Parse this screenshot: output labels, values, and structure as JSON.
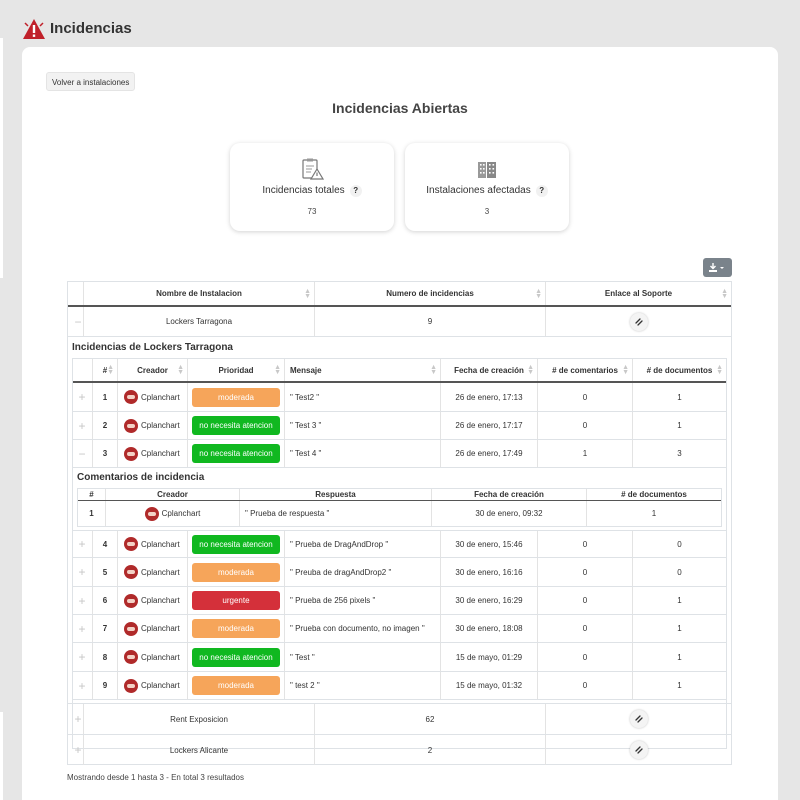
{
  "header": {
    "title": "Incidencias",
    "icon": "warning-triangle-icon",
    "accent": "#c0202a"
  },
  "back_button": "Volver a instalaciones",
  "section_title": "Incidencias Abiertas",
  "stats": [
    {
      "label": "Incidencias totales",
      "help": "?",
      "value": "73",
      "icon": "clipboard-warning-icon"
    },
    {
      "label": "Instalaciones afectadas",
      "help": "?",
      "value": "3",
      "icon": "building-icon"
    }
  ],
  "main_table": {
    "headers": [
      "Nombre de Instalacion",
      "Numero de incidencias",
      "Enlace al Soporte"
    ],
    "rows": [
      {
        "name": "Lockers Tarragona",
        "count": "9",
        "expanded": "−"
      },
      {
        "name": "Rent Exposicion",
        "count": "62",
        "expanded": "+"
      },
      {
        "name": "Lockers Alicante",
        "count": "2",
        "expanded": "+"
      }
    ]
  },
  "incidents": {
    "title": "Incidencias de Lockers Tarragona",
    "headers": [
      "#",
      "Creador",
      "Prioridad",
      "Mensaje",
      "Fecha de creación",
      "# de comentarios",
      "# de documentos"
    ],
    "rows": [
      {
        "exp": "+",
        "num": "1",
        "creator": "Cplanchart",
        "priority": "moderada",
        "message": "\" Test2 \"",
        "date": "26 de enero, 17:13",
        "comments": "0",
        "docs": "1"
      },
      {
        "exp": "+",
        "num": "2",
        "creator": "Cplanchart",
        "priority": "no necesita atencion",
        "message": "\" Test 3 \"",
        "date": "26 de enero, 17:17",
        "comments": "0",
        "docs": "1"
      },
      {
        "exp": "−",
        "num": "3",
        "creator": "Cplanchart",
        "priority": "no necesita atencion",
        "message": "\" Test 4 \"",
        "date": "26 de enero, 17:49",
        "comments": "1",
        "docs": "3"
      },
      {
        "exp": "+",
        "num": "4",
        "creator": "Cplanchart",
        "priority": "no necesita atencion",
        "message": "\" Prueba de DragAndDrop \"",
        "date": "30 de enero, 15:46",
        "comments": "0",
        "docs": "0"
      },
      {
        "exp": "+",
        "num": "5",
        "creator": "Cplanchart",
        "priority": "moderada",
        "message": "\" Preuba de dragAndDrop2 \"",
        "date": "30 de enero, 16:16",
        "comments": "0",
        "docs": "0"
      },
      {
        "exp": "+",
        "num": "6",
        "creator": "Cplanchart",
        "priority": "urgente",
        "message": "\" Prueba de 256 pixels \"",
        "date": "30 de enero, 16:29",
        "comments": "0",
        "docs": "1"
      },
      {
        "exp": "+",
        "num": "7",
        "creator": "Cplanchart",
        "priority": "moderada",
        "message": "\" Prueba con documento, no imagen \"",
        "date": "30 de enero, 18:08",
        "comments": "0",
        "docs": "1"
      },
      {
        "exp": "+",
        "num": "8",
        "creator": "Cplanchart",
        "priority": "no necesita atencion",
        "message": "\" Test \"",
        "date": "15 de mayo, 01:29",
        "comments": "0",
        "docs": "1"
      },
      {
        "exp": "+",
        "num": "9",
        "creator": "Cplanchart",
        "priority": "moderada",
        "message": "\" test 2 \"",
        "date": "15 de mayo, 01:32",
        "comments": "0",
        "docs": "1"
      }
    ]
  },
  "comments": {
    "title": "Comentarios de incidencia",
    "headers": [
      "#",
      "Creador",
      "Respuesta",
      "Fecha de creación",
      "# de documentos"
    ],
    "rows": [
      {
        "num": "1",
        "creator": "Cplanchart",
        "response": "\" Prueba de respuesta \"",
        "date": "30 de enero, 09:32",
        "docs": "1"
      }
    ]
  },
  "priority_colors": {
    "moderada": "#f6a55a",
    "no necesita atencion": "#10b820",
    "urgente": "#d4303a"
  },
  "footer": "Mostrando desde 1 hasta 3 - En total 3 resultados"
}
